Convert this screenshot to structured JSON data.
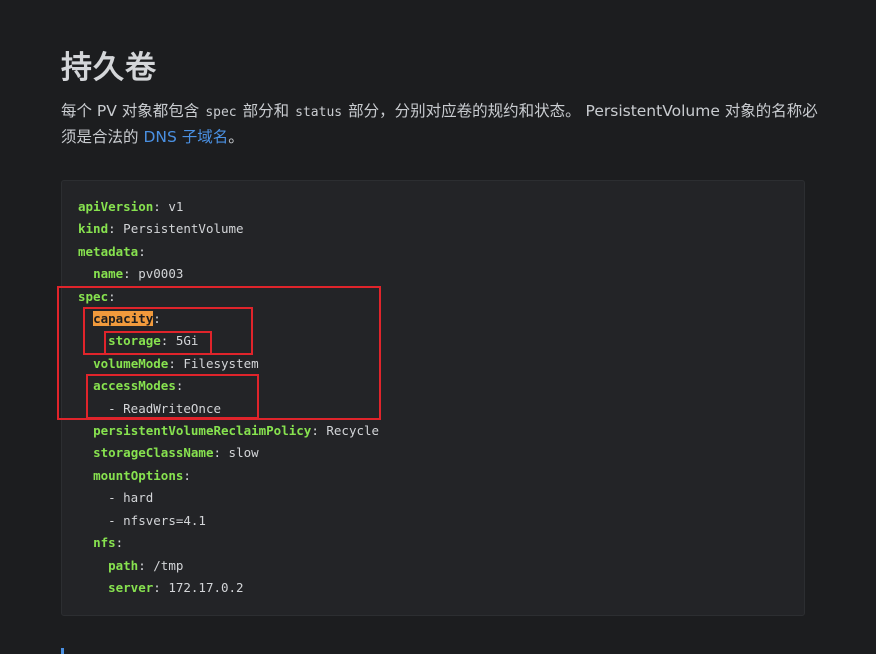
{
  "page": {
    "title": "持久卷",
    "para": {
      "t1": "每个 PV 对象都包含",
      "c1": "spec",
      "t2": "部分和",
      "c2": "status",
      "t3": "部分，分别对应卷的规约和状态。 PersistentVolume 对象的名称必须是合法的",
      "link": "DNS 子域名",
      "t4": "。"
    }
  },
  "code": {
    "lines": [
      {
        "indent": "",
        "key": "apiVersion",
        "sep": ": ",
        "value": "v1"
      },
      {
        "indent": "",
        "key": "kind",
        "sep": ": ",
        "value": "PersistentVolume"
      },
      {
        "indent": "",
        "key": "metadata",
        "sep": ":",
        "value": ""
      },
      {
        "indent": "  ",
        "key": "name",
        "sep": ": ",
        "value": "pv0003"
      },
      {
        "indent": "",
        "key": "spec",
        "sep": ":",
        "value": ""
      },
      {
        "indent": "  ",
        "key": "capacity",
        "sep": ":",
        "value": "",
        "highlight": true
      },
      {
        "indent": "    ",
        "key": "storage",
        "sep": ": ",
        "value": "5Gi"
      },
      {
        "indent": "  ",
        "key": "volumeMode",
        "sep": ": ",
        "value": "Filesystem"
      },
      {
        "indent": "  ",
        "key": "accessModes",
        "sep": ":",
        "value": ""
      },
      {
        "indent": "    ",
        "key": "",
        "sep": "",
        "value": "- ReadWriteOnce"
      },
      {
        "indent": "  ",
        "key": "persistentVolumeReclaimPolicy",
        "sep": ": ",
        "value": "Recycle"
      },
      {
        "indent": "  ",
        "key": "storageClassName",
        "sep": ": ",
        "value": "slow"
      },
      {
        "indent": "  ",
        "key": "mountOptions",
        "sep": ":",
        "value": ""
      },
      {
        "indent": "    ",
        "key": "",
        "sep": "",
        "value": "- hard"
      },
      {
        "indent": "    ",
        "key": "",
        "sep": "",
        "value": "- nfsvers=4.1"
      },
      {
        "indent": "  ",
        "key": "nfs",
        "sep": ":",
        "value": ""
      },
      {
        "indent": "    ",
        "key": "path",
        "sep": ": ",
        "value": "/tmp"
      },
      {
        "indent": "    ",
        "key": "server",
        "sep": ": ",
        "value": "172.17.0.2"
      }
    ]
  },
  "colors": {
    "key": "#87e24f",
    "highlight": "#f19a3c",
    "annotation_box": "#e0242b",
    "link": "#4a90e2"
  }
}
